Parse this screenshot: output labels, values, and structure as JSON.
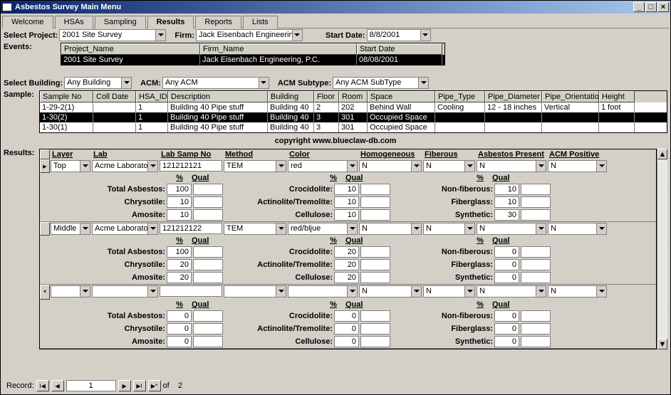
{
  "title": "Asbestos Survey Main Menu",
  "tabs": [
    "Welcome",
    "HSAs",
    "Sampling",
    "Results",
    "Reports",
    "Lists"
  ],
  "active_tab": "Results",
  "filters": {
    "select_project": "Select Project:",
    "project": "2001 Site Survey",
    "firm_lbl": "Firm:",
    "firm": "Jack Eisenbach Engineerin",
    "start_date_lbl": "Start Date:",
    "start_date": "8/8/2001",
    "events_lbl": "Events:",
    "select_building_lbl": "Select Building:",
    "building": "Any Building",
    "acm_lbl": "ACM:",
    "acm": "Any ACM",
    "acm_sub_lbl": "ACM Subtype:",
    "acm_sub": "Any ACM SubType",
    "sample_lbl": "Sample:"
  },
  "events_grid": {
    "headers": [
      "Project_Name",
      "Firm_Name",
      "Start Date"
    ],
    "rows": [
      {
        "Project_Name": "2001 Site Survey",
        "Firm_Name": "Jack Eisenbach Engineering, P.C.",
        "Start Date": "08/08/2001",
        "sel": true
      }
    ]
  },
  "sample_grid": {
    "headers": [
      "Sample No",
      "Coll Date",
      "HSA_ID",
      "Description",
      "Building",
      "Floor",
      "Room",
      "Space",
      "Pipe_Type",
      "Pipe_Diameter",
      "Pipe_Orientatio",
      "Height"
    ],
    "rows": [
      {
        "Sample No": "1-29-2(1)",
        "Coll Date": "",
        "HSA_ID": "1",
        "Description": "Building 40 Pipe stuff",
        "Building": "Building 40",
        "Floor": "2",
        "Room": "202",
        "Space": "Behind Wall",
        "Pipe_Type": "Cooling",
        "Pipe_Diameter": "12 - 18 inches",
        "Pipe_Orientatio": "Vertical",
        "Height": "1 foot"
      },
      {
        "Sample No": "1-30(2)",
        "Coll Date": "",
        "HSA_ID": "1",
        "Description": "Building 40 Pipe stuff",
        "Building": "Building 40",
        "Floor": "3",
        "Room": "301",
        "Space": "Occupied Space",
        "Pipe_Type": "",
        "Pipe_Diameter": "",
        "Pipe_Orientatio": "",
        "Height": "",
        "sel": true
      },
      {
        "Sample No": "1-30(1)",
        "Coll Date": "",
        "HSA_ID": "1",
        "Description": "Building 40 Pipe stuff",
        "Building": "Building 40",
        "Floor": "3",
        "Room": "301",
        "Space": "Occupied Space",
        "Pipe_Type": "",
        "Pipe_Diameter": "",
        "Pipe_Orientatio": "",
        "Height": ""
      }
    ]
  },
  "copyright": "copyright www.blueclaw-db.com",
  "results": {
    "label": "Results:",
    "headers": [
      "Layer",
      "Lab",
      "Lab Samp No",
      "Method",
      "Color",
      "Homogeneous",
      "Fiberous",
      "Asbestos Present",
      "ACM Positive"
    ],
    "param_labels": {
      "pct": "%",
      "qual": "Qual",
      "total_asbestos": "Total Asbestos:",
      "chrysotile": "Chrysotile:",
      "amosite": "Amosite:",
      "crocidolite": "Crocidolite:",
      "act_trem": "Actinolite/Tremolite:",
      "cellulose": "Cellulose:",
      "non_fiberous": "Non-fiberous:",
      "fiberglass": "Fiberglass:",
      "synthetic": "Synthetic:"
    },
    "rows": [
      {
        "Layer": "Top",
        "Lab": "Acme Laborator",
        "Lab Samp No": "121212121",
        "Method": "TEM",
        "Color": "red",
        "Homogeneous": "N",
        "Fiberous": "N",
        "Asbestos Present": "N",
        "ACM Positive": "N",
        "vals": {
          "total_asbestos": "100",
          "chrysotile": "10",
          "amosite": "10",
          "crocidolite": "10",
          "act_trem": "10",
          "cellulose": "10",
          "non_fiberous": "10",
          "fiberglass": "10",
          "synthetic": "30"
        }
      },
      {
        "Layer": "Middle",
        "Lab": "Acme Laborator",
        "Lab Samp No": "121212122",
        "Method": "TEM",
        "Color": "red/bljue",
        "Homogeneous": "N",
        "Fiberous": "N",
        "Asbestos Present": "N",
        "ACM Positive": "N",
        "vals": {
          "total_asbestos": "100",
          "chrysotile": "20",
          "amosite": "20",
          "crocidolite": "20",
          "act_trem": "20",
          "cellulose": "20",
          "non_fiberous": "0",
          "fiberglass": "0",
          "synthetic": "0"
        }
      },
      {
        "Layer": "",
        "Lab": "",
        "Lab Samp No": "",
        "Method": "",
        "Color": "",
        "Homogeneous": "N",
        "Fiberous": "N",
        "Asbestos Present": "N",
        "ACM Positive": "N",
        "new": true,
        "vals": {
          "total_asbestos": "0",
          "chrysotile": "0",
          "amosite": "0",
          "crocidolite": "0",
          "act_trem": "0",
          "cellulose": "0",
          "non_fiberous": "0",
          "fiberglass": "0",
          "synthetic": "0"
        }
      }
    ]
  },
  "record": {
    "label": "Record:",
    "current": "1",
    "of": "of",
    "total": "2"
  }
}
